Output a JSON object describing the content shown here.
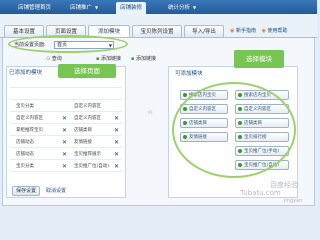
{
  "top_nav": {
    "items": [
      {
        "label": "店铺管理首页",
        "active": false,
        "has_arrow": false
      },
      {
        "label": "店铺推广",
        "active": false,
        "has_arrow": true
      },
      {
        "label": "店铺装修",
        "active": true,
        "has_arrow": false
      },
      {
        "label": "统计分析",
        "active": false,
        "has_arrow": true
      }
    ]
  },
  "sub_tabs": [
    {
      "label": "基本设置",
      "active": false
    },
    {
      "label": "页面设置",
      "active": false
    },
    {
      "label": "添加模块",
      "active": true
    },
    {
      "label": "宝贝陈列设置",
      "active": false
    },
    {
      "label": "导入/导出",
      "active": false
    }
  ],
  "help_links": [
    "新手指南",
    "使用帮助"
  ],
  "page_select": {
    "label": "当前设置页面:",
    "value": "首页"
  },
  "toolbar": {
    "search_text": "查询",
    "buttons": [
      "添加链接",
      "添加链接"
    ]
  },
  "left_panel": {
    "title": "已添加的模块",
    "rows": [
      {
        "name": "",
        "left": "",
        "label": "",
        "right": "",
        "removable": false
      },
      {
        "name": "",
        "left": "",
        "label": "",
        "right": "",
        "removable": false
      },
      {
        "name": "",
        "left": "宝贝分类",
        "label": "自定义内容区",
        "right": "",
        "removable": false
      },
      {
        "name": "自定义内容区",
        "left": "",
        "label": "自定义内容区",
        "right": "",
        "removable": true
      },
      {
        "name": "掌柜推荐宝贝",
        "left": "",
        "label": "店铺类目",
        "right": "",
        "removable": true
      },
      {
        "name": "店铺动态",
        "left": "",
        "label": "友情链接",
        "right": "",
        "removable": true
      },
      {
        "name": "店铺动态",
        "left": "",
        "label": "宝贝推荐展示",
        "right": "",
        "removable": true
      },
      {
        "name": "宝贝分类",
        "left": "",
        "label": "宝贝推广位(自动)",
        "right": "",
        "removable": true
      }
    ]
  },
  "right_panel": {
    "title": "可添加模块",
    "modules_left": [
      "搜索店内宝贝",
      "自定义内容区",
      "店铺类目",
      "友情链接"
    ],
    "modules_right": [
      "搜索店内宝贝",
      "自定义内容区",
      "店铺类目",
      "宝贝排行榜",
      "宝贝推广位(手动)",
      "宝贝推广位(自动)"
    ]
  },
  "footer": {
    "save_label": "保存设置",
    "cancel_label": "取消设置"
  },
  "callouts": {
    "page": "选择页面",
    "module": "选择模块"
  },
  "watermark": {
    "line1": "百度经验",
    "line2": "Tubatu.com",
    "line3": "jingyan"
  },
  "colors": {
    "nav_blue": "#1d4e86",
    "callout_green": "#77c653",
    "ring_green": "#9dd26b"
  }
}
